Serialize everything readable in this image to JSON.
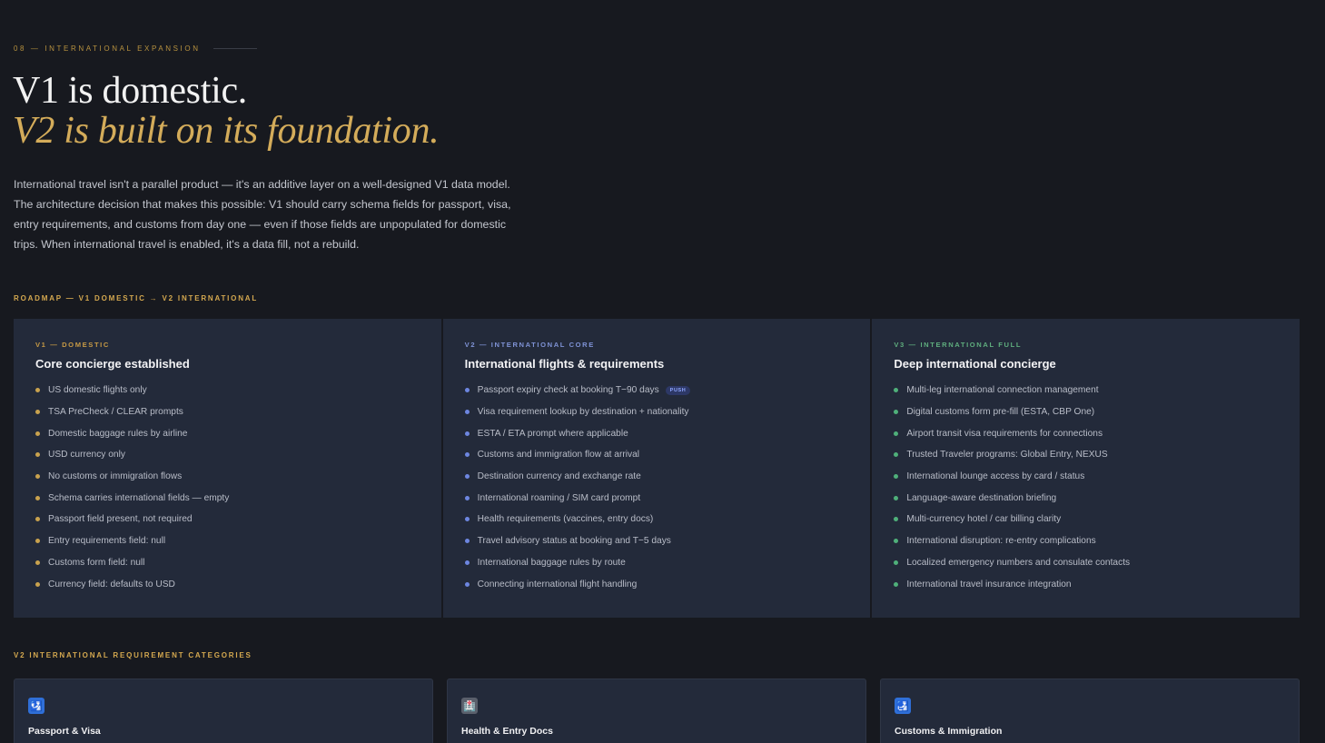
{
  "eyebrow": "08 — International Expansion",
  "headline": {
    "line1": "V1 is domestic.",
    "line2": "V2 is built on its foundation."
  },
  "intro": "International travel isn't a parallel product — it's an additive layer on a well-designed V1 data model. The architecture decision that makes this possible: V1 should carry schema fields for passport, visa, entry requirements, and customs from day one — even if those fields are unpopulated for domestic trips. When international travel is enabled, it's a data fill, not a rebuild.",
  "roadmap_label": "Roadmap — V1 Domestic → V2 International",
  "phases": [
    {
      "tag": "V1 — Domestic",
      "tag_color": "#c79a45",
      "dot_color": "#c9a24e",
      "title": "Core concierge established",
      "items": [
        "US domestic flights only",
        "TSA PreCheck / CLEAR prompts",
        "Domestic baggage rules by airline",
        "USD currency only",
        "No customs or immigration flows",
        "Schema carries international fields — empty",
        "Passport field present, not required",
        "Entry requirements field: null",
        "Customs form field: null",
        "Currency field: defaults to USD"
      ]
    },
    {
      "tag": "V2 — International Core",
      "tag_color": "#7f93d6",
      "dot_color": "#6d86e0",
      "title": "International flights & requirements",
      "badge": "PUSH",
      "items": [
        "Passport expiry check at booking T−90 days",
        "Visa requirement lookup by destination + nationality",
        "ESTA / ETA prompt where applicable",
        "Customs and immigration flow at arrival",
        "Destination currency and exchange rate",
        "International roaming / SIM card prompt",
        "Health requirements (vaccines, entry docs)",
        "Travel advisory status at booking and T−5 days",
        "International baggage rules by route",
        "Connecting international flight handling"
      ]
    },
    {
      "tag": "V3 — International Full",
      "tag_color": "#5fae7e",
      "dot_color": "#4fb07a",
      "title": "Deep international concierge",
      "items": [
        "Multi-leg international connection management",
        "Digital customs form pre-fill (ESTA, CBP One)",
        "Airport transit visa requirements for connections",
        "Trusted Traveler programs: Global Entry, NEXUS",
        "International lounge access by card / status",
        "Language-aware destination briefing",
        "Multi-currency hotel / car billing clarity",
        "International disruption: re-entry complications",
        "Localized emergency numbers and consulate contacts",
        "International travel insurance integration"
      ]
    }
  ],
  "categories_label": "V2 International Requirement Categories",
  "categories": [
    {
      "icon": "passport-icon",
      "glyph": "🛂",
      "bg": "#2f6fd8",
      "title": "Passport & Visa"
    },
    {
      "icon": "hospital-icon",
      "glyph": "🏥",
      "bg": "#5a5f6b",
      "title": "Health & Entry Docs"
    },
    {
      "icon": "customs-icon",
      "glyph": "🛃",
      "bg": "#2f6fd8",
      "title": "Customs & Immigration"
    }
  ]
}
